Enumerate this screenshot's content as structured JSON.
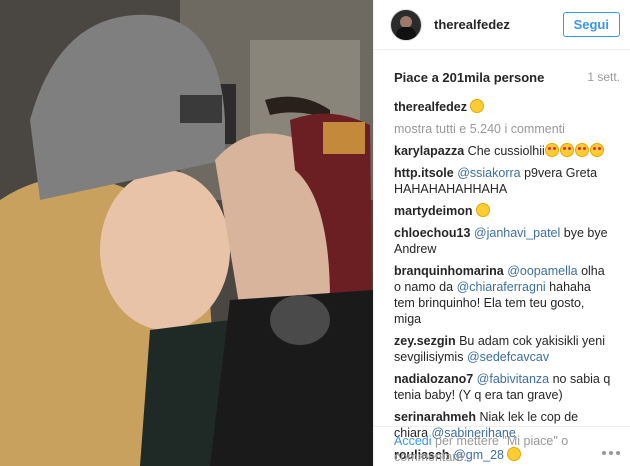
{
  "post": {
    "photo_alt": "",
    "author": "therealfedez",
    "follow_label": "Segui",
    "likes_text": "Piace a 201mila persone",
    "time_ago": "1 sett.",
    "caption_user": "therealfedez",
    "more_comments": "mostra tutti e 5.240 i commenti"
  },
  "comments": [
    {
      "user": "karylapazza",
      "text": "Che cussiolhii"
    },
    {
      "user": "http.itsole",
      "mention": "@ssiakorra",
      "text": "p9vera Greta HAHAHAHAHHAHA"
    },
    {
      "user": "martydeimon",
      "text": ""
    },
    {
      "user": "chloechou13",
      "mention": "@janhavi_patel",
      "text": "bye bye Andrew"
    },
    {
      "user": "branquinhomarina",
      "mention": "@oopamella",
      "text": "olha o namo da",
      "mention2": "@chiaraferragni",
      "text2": "hahaha tem brinquinho! Ela tem teu gosto, miga"
    },
    {
      "user": "zey.sezgin",
      "text": "Bu adam cok yakisikli yeni sevgilisiymis",
      "mention2": "@sedefcavcav"
    },
    {
      "user": "nadialozano7",
      "mention": "@fabivitanza",
      "text": "no sabia q tenia baby! (Y q era tan grave)"
    },
    {
      "user": "serinarahmeh",
      "text": "Niak lek le cop de chiara",
      "mention2": "@sabinerihane"
    },
    {
      "user": "rouliasch",
      "mention": "@gm_28",
      "text": ""
    }
  ],
  "footer": {
    "login_link": "Accedi",
    "login_text": "per mettere \"Mi piace\" o commentare."
  },
  "colors": {
    "accent": "#3897f0",
    "mention": "#3d6fa0"
  },
  "icons": [
    "more-options-icon",
    "emoji-icon"
  ]
}
